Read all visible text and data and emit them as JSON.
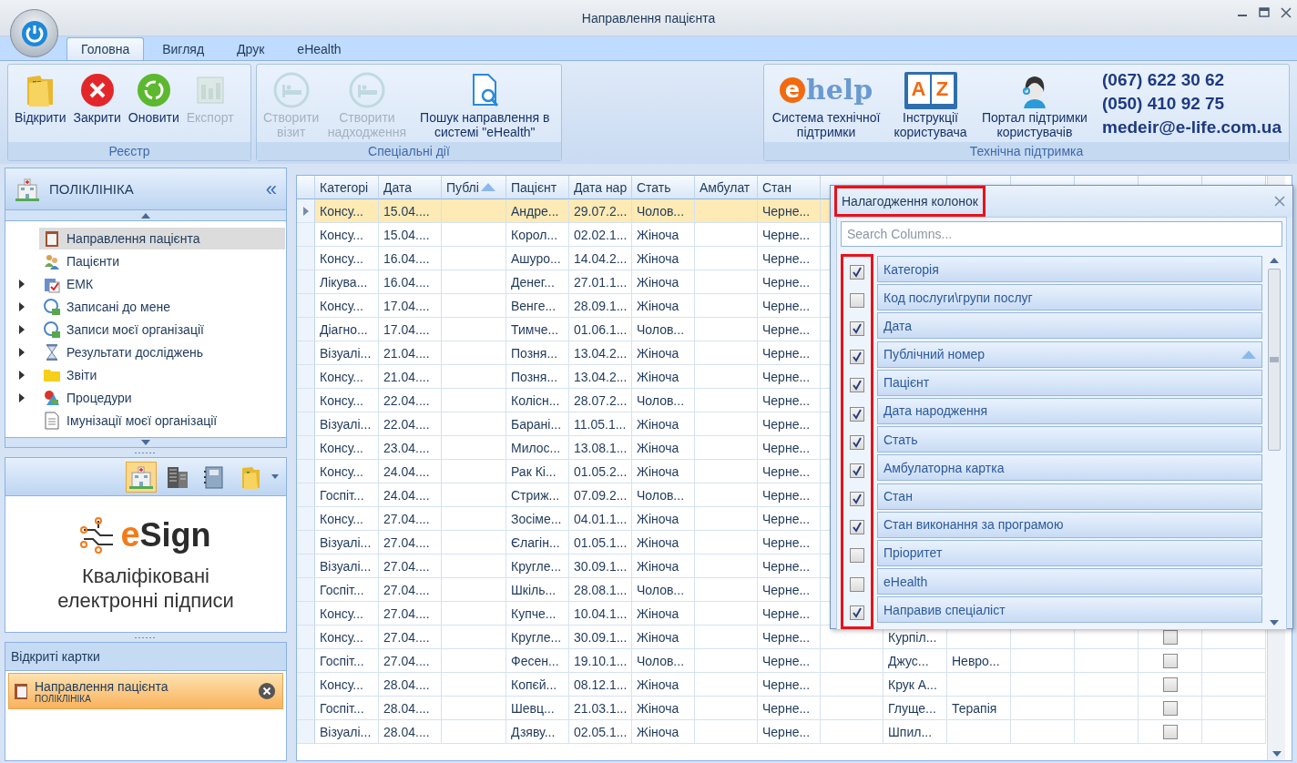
{
  "window": {
    "title": "Направлення пацієнта"
  },
  "ribbon": {
    "tabs": [
      {
        "label": "Головна",
        "selected": true
      },
      {
        "label": "Вигляд",
        "selected": false
      },
      {
        "label": "Друк",
        "selected": false
      },
      {
        "label": "eHealth",
        "selected": false
      }
    ],
    "groups": [
      {
        "title": "Реєстр",
        "buttons": [
          {
            "label": "Відкрити",
            "disabled": false
          },
          {
            "label": "Закрити",
            "disabled": false
          },
          {
            "label": "Оновити",
            "disabled": false
          },
          {
            "label": "Експорт",
            "disabled": true
          }
        ]
      },
      {
        "title": "Спеціальні дії",
        "buttons": [
          {
            "label": "Створити візит",
            "disabled": true
          },
          {
            "label": "Створити надходження",
            "disabled": true
          },
          {
            "label": "Пошук направлення в системі \"eHealth\"",
            "disabled": false
          }
        ]
      }
    ],
    "support": {
      "title": "Технічна підтримка",
      "help": {
        "logo_mark": "e",
        "logo_word": "help",
        "label": "Система технічної підтримки"
      },
      "manual": {
        "letters": [
          "A",
          "Z"
        ],
        "label": "Інструкції користувача"
      },
      "portal": {
        "label": "Портал підтримки користувачів"
      },
      "contacts": [
        "(067) 622 30 62",
        "(050) 410 92 75",
        "medeir@e-life.com.ua"
      ]
    }
  },
  "sidebar": {
    "title": "ПОЛІКЛІНІКА",
    "collapse": "«",
    "items": [
      {
        "label": "Направлення пацієнта",
        "expandable": false,
        "selected": true
      },
      {
        "label": "Пацієнти",
        "expandable": false,
        "selected": false
      },
      {
        "label": "ЕМК",
        "expandable": true,
        "selected": false
      },
      {
        "label": "Записані до мене",
        "expandable": true,
        "selected": false
      },
      {
        "label": "Записи моєї організації",
        "expandable": true,
        "selected": false
      },
      {
        "label": "Результати досліджень",
        "expandable": true,
        "selected": false
      },
      {
        "label": "Звіти",
        "expandable": true,
        "selected": false
      },
      {
        "label": "Процедури",
        "expandable": true,
        "selected": false
      },
      {
        "label": "Імунізації моєї організації",
        "expandable": false,
        "selected": false
      }
    ],
    "shortcuts": [
      {
        "selected": true
      },
      {
        "selected": false
      },
      {
        "selected": false
      },
      {
        "selected": false
      }
    ],
    "banner": {
      "logo_mark": "e",
      "logo_word": "Sign",
      "caption": "Кваліфіковані електронні підписи"
    },
    "open_cards": {
      "title": "Відкриті картки",
      "cards": [
        {
          "title": "Направлення пацієнта",
          "subtitle": "ПОЛІКЛІНІКА",
          "selected": true
        }
      ]
    }
  },
  "grid": {
    "columns": [
      {
        "label": "Категорі",
        "sorted": false
      },
      {
        "label": "Дата",
        "sorted": false
      },
      {
        "label": "Публі",
        "sorted": true
      },
      {
        "label": "Пацієнт",
        "sorted": false
      },
      {
        "label": "Дата нар",
        "sorted": false
      },
      {
        "label": "Стать",
        "sorted": false
      },
      {
        "label": "Амбулат",
        "sorted": false
      },
      {
        "label": "Стан",
        "sorted": false
      }
    ],
    "rows": [
      {
        "selected": true,
        "cells": [
          "Консу...",
          "15.04....",
          null,
          "Андре...",
          "29.07.2...",
          "Чолов...",
          null,
          "Черне..."
        ]
      },
      {
        "selected": false,
        "cells": [
          "Консу...",
          "15.04....",
          null,
          "Корол...",
          "02.02.1...",
          "Жіноча",
          null,
          "Черне..."
        ]
      },
      {
        "selected": false,
        "cells": [
          "Консу...",
          "16.04....",
          null,
          "Ашуро...",
          "14.04.2...",
          "Жіноча",
          null,
          "Черне..."
        ]
      },
      {
        "selected": false,
        "cells": [
          "Лікува...",
          "16.04....",
          null,
          "Денег...",
          "27.01.1...",
          "Жіноча",
          null,
          "Черне..."
        ]
      },
      {
        "selected": false,
        "cells": [
          "Консу...",
          "17.04....",
          null,
          "Венге...",
          "28.09.1...",
          "Жіноча",
          null,
          "Черне..."
        ]
      },
      {
        "selected": false,
        "cells": [
          "Діагно...",
          "17.04....",
          null,
          "Тимче...",
          "01.06.1...",
          "Чолов...",
          null,
          "Черне..."
        ]
      },
      {
        "selected": false,
        "cells": [
          "Візуалі...",
          "21.04....",
          null,
          "Позня...",
          "13.04.2...",
          "Жіноча",
          null,
          "Черне..."
        ]
      },
      {
        "selected": false,
        "cells": [
          "Консу...",
          "21.04....",
          null,
          "Позня...",
          "13.04.2...",
          "Жіноча",
          null,
          "Черне..."
        ]
      },
      {
        "selected": false,
        "cells": [
          "Консу...",
          "22.04....",
          null,
          "Колісн...",
          "28.07.2...",
          "Чолов...",
          null,
          "Черне..."
        ]
      },
      {
        "selected": false,
        "cells": [
          "Візуалі...",
          "22.04....",
          null,
          "Барані...",
          "11.05.1...",
          "Жіноча",
          null,
          "Черне..."
        ]
      },
      {
        "selected": false,
        "cells": [
          "Консу...",
          "23.04....",
          null,
          "Милос...",
          "13.08.1...",
          "Жіноча",
          null,
          "Черне..."
        ]
      },
      {
        "selected": false,
        "cells": [
          "Консу...",
          "24.04....",
          null,
          "Рак Кі...",
          "01.05.2...",
          "Жіноча",
          null,
          "Черне..."
        ]
      },
      {
        "selected": false,
        "cells": [
          "Госпіт...",
          "24.04....",
          null,
          "Стриж...",
          "07.09.2...",
          "Чолов...",
          null,
          "Черне..."
        ]
      },
      {
        "selected": false,
        "cells": [
          "Консу...",
          "27.04....",
          null,
          "Зосіме...",
          "04.01.1...",
          "Жіноча",
          null,
          "Черне..."
        ]
      },
      {
        "selected": false,
        "cells": [
          "Візуалі...",
          "27.04....",
          null,
          "Єлагін...",
          "01.05.1...",
          "Жіноча",
          null,
          "Черне..."
        ]
      },
      {
        "selected": false,
        "cells": [
          "Візуалі...",
          "27.04....",
          null,
          "Кругле...",
          "30.09.1...",
          "Жіноча",
          null,
          "Черне..."
        ]
      },
      {
        "selected": false,
        "cells": [
          "Госпіт...",
          "27.04....",
          null,
          "Шкіль...",
          "28.08.1...",
          "Чолов...",
          null,
          "Черне..."
        ]
      },
      {
        "selected": false,
        "cells": [
          "Консу...",
          "27.04....",
          null,
          "Купче...",
          "10.04.1...",
          "Жіноча",
          null,
          "Черне..."
        ]
      },
      {
        "selected": false,
        "cells": [
          "Консу...",
          "27.04....",
          null,
          "Кругле...",
          "30.09.1...",
          "Жіноча",
          null,
          "Черне..."
        ],
        "extra_cells": [
          null,
          "Курпіл...",
          null,
          null,
          null
        ],
        "extra_checked": false
      },
      {
        "selected": false,
        "cells": [
          "Госпіт...",
          "27.04....",
          null,
          "Фесен...",
          "19.10.1...",
          "Чолов...",
          null,
          "Черне..."
        ],
        "extra_cells": [
          null,
          "Джус...",
          "Невро...",
          null,
          null
        ],
        "extra_checked": false
      },
      {
        "selected": false,
        "cells": [
          "Консу...",
          "28.04....",
          null,
          "Копєй...",
          "08.12.1...",
          "Жіноча",
          null,
          "Черне..."
        ],
        "extra_cells": [
          null,
          "Крук А...",
          null,
          null,
          null
        ],
        "extra_checked": false
      },
      {
        "selected": false,
        "cells": [
          "Госпіт...",
          "28.04....",
          null,
          "Шевц...",
          "21.03.1...",
          "Жіноча",
          null,
          "Черне..."
        ],
        "extra_cells": [
          null,
          "Глуще...",
          "Терапія",
          null,
          null
        ],
        "extra_checked": false
      },
      {
        "selected": false,
        "cells": [
          "Візуалі...",
          "28.04....",
          null,
          "Дзяву...",
          "02.05.1...",
          "Жіноча",
          null,
          "Черне..."
        ],
        "extra_cells": [
          null,
          "Шпил...",
          null,
          null,
          null
        ],
        "extra_checked": false
      }
    ]
  },
  "column_chooser": {
    "title": "Налагодження колонок",
    "title_highlighted": true,
    "checks_highlighted": true,
    "search": {
      "placeholder": "Search Columns..."
    },
    "items": [
      {
        "label": "Категорія",
        "checked": true,
        "sorted": false
      },
      {
        "label": "Код послуги\\групи послуг",
        "checked": false,
        "sorted": false
      },
      {
        "label": "Дата",
        "checked": true,
        "sorted": false
      },
      {
        "label": "Публічний номер",
        "checked": true,
        "sorted": true
      },
      {
        "label": "Пацієнт",
        "checked": true,
        "sorted": false
      },
      {
        "label": "Дата народження",
        "checked": true,
        "sorted": false
      },
      {
        "label": "Стать",
        "checked": true,
        "sorted": false
      },
      {
        "label": "Амбулаторна картка",
        "checked": true,
        "sorted": false
      },
      {
        "label": "Стан",
        "checked": true,
        "sorted": false
      },
      {
        "label": "Стан виконання за програмою",
        "checked": true,
        "sorted": false
      },
      {
        "label": "Пріоритет",
        "checked": false,
        "sorted": false
      },
      {
        "label": "eHealth",
        "checked": false,
        "sorted": false
      },
      {
        "label": "Направив спеціаліст",
        "checked": true,
        "sorted": false
      }
    ]
  }
}
